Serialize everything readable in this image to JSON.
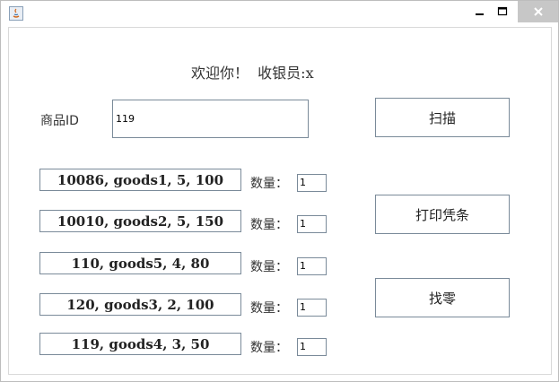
{
  "window": {
    "controls": {
      "minimize": "minimize-icon",
      "maximize": "maximize-icon",
      "close": "close-icon"
    }
  },
  "header": {
    "welcome": "欢迎你！  收银员:x"
  },
  "product_id": {
    "label": "商品ID",
    "value": "119"
  },
  "buttons": {
    "scan": "扫描",
    "print_receipt": "打印凭条",
    "change": "找零"
  },
  "quantity_label": "数量：",
  "items": [
    {
      "text": "10086, goods1, 5, 100",
      "qty": "1"
    },
    {
      "text": "10010, goods2, 5, 150",
      "qty": "1"
    },
    {
      "text": "110, goods5, 4, 80",
      "qty": "1"
    },
    {
      "text": "120, goods3, 2, 100",
      "qty": "1"
    },
    {
      "text": "119, goods4, 3, 50",
      "qty": "1"
    }
  ]
}
